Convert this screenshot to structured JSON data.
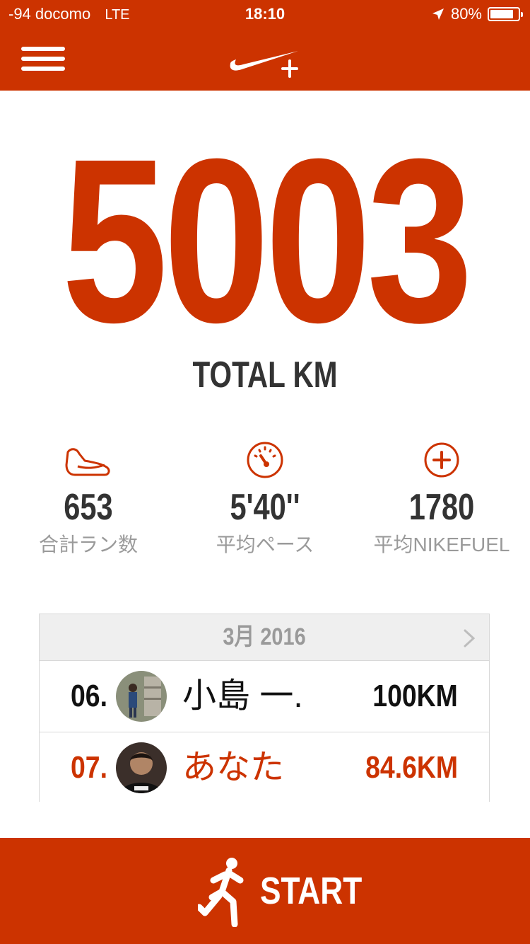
{
  "status_bar": {
    "carrier": "-94 docomo",
    "network": "LTE",
    "time": "18:10",
    "battery_text": "80%",
    "battery_level": 0.8
  },
  "header": {
    "menu_icon": "hamburger-menu-icon",
    "logo_icon": "nike-plus-logo"
  },
  "total": {
    "value": "5003",
    "label": "TOTAL KM"
  },
  "stats": [
    {
      "icon": "shoe-icon",
      "value": "653",
      "label": "合計ラン数"
    },
    {
      "icon": "speedometer-icon",
      "value": "5'40''",
      "label": "平均ペース"
    },
    {
      "icon": "fuel-plus-icon",
      "value": "1780",
      "label": "平均NIKEFUEL"
    }
  ],
  "leaderboard": {
    "month": "3月 2016",
    "rows": [
      {
        "rank": "06.",
        "name": "小島 一.",
        "distance": "100KM",
        "is_me": false
      },
      {
        "rank": "07.",
        "name": "あなた",
        "distance": "84.6KM",
        "is_me": true
      }
    ]
  },
  "start_button": {
    "label": "START",
    "icon": "runner-icon"
  },
  "colors": {
    "accent": "#cc3300",
    "text_dark": "#333333",
    "text_gray": "#9a9a9a"
  }
}
